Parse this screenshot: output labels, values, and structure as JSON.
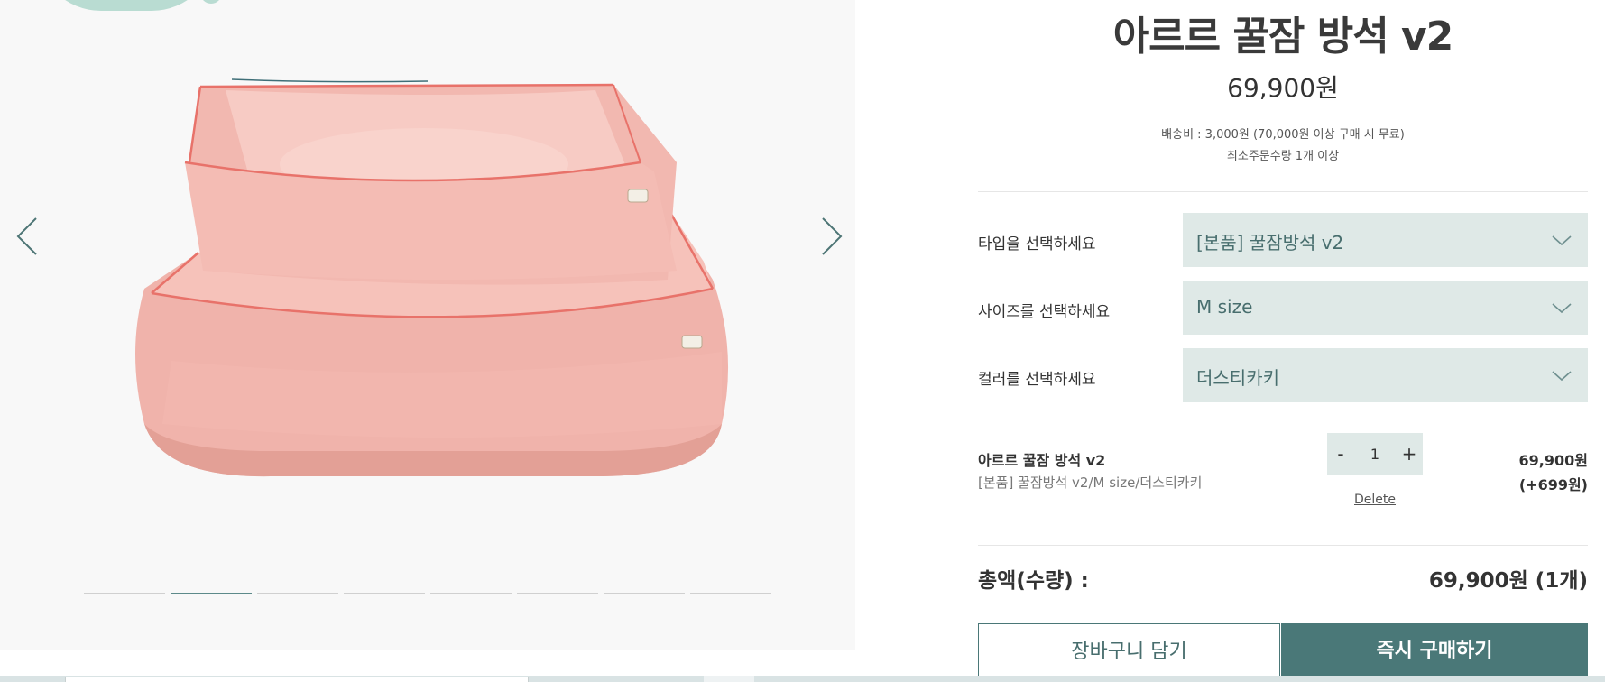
{
  "product": {
    "title": "아르르 꿀잠 방석 v2",
    "price": "69,900원",
    "shipping": "배송비 : 3,000원 (70,000원 이상 구매 시 무료)",
    "min_order": "최소주문수량 1개 이상"
  },
  "gallery": {
    "prev_icon": "chevron-left-icon",
    "next_icon": "chevron-right-icon",
    "indicator_count": 8,
    "active_indicator": 2
  },
  "options": [
    {
      "label": "타입을 선택하세요",
      "value": "[본품] 꿀잠방석 v2"
    },
    {
      "label": "사이즈를 선택하세요",
      "value": "M size"
    },
    {
      "label": "컬러를 선택하세요",
      "value": "더스티카키"
    }
  ],
  "selected_item": {
    "name": "아르르 꿀잠 방석 v2",
    "detail": "[본품] 꿀잠방석 v2/M size/더스티카키",
    "qty_minus": "-",
    "qty_plus": "+",
    "quantity": "1",
    "delete_label": "Delete",
    "price": "69,900원",
    "points": "(+699원)"
  },
  "total": {
    "label": "총액(수량) :",
    "value": "69,900원 (1개)"
  },
  "buttons": {
    "cart": "장바구니 담기",
    "buy": "즉시 구매하기"
  },
  "colors": {
    "accent": "#4a7878",
    "select_bg": "#dfe9e7",
    "select_text": "#486e6e",
    "bubble": "#b9dcd2",
    "product_pink": "#f4b9b2",
    "piping": "#e8726a"
  }
}
